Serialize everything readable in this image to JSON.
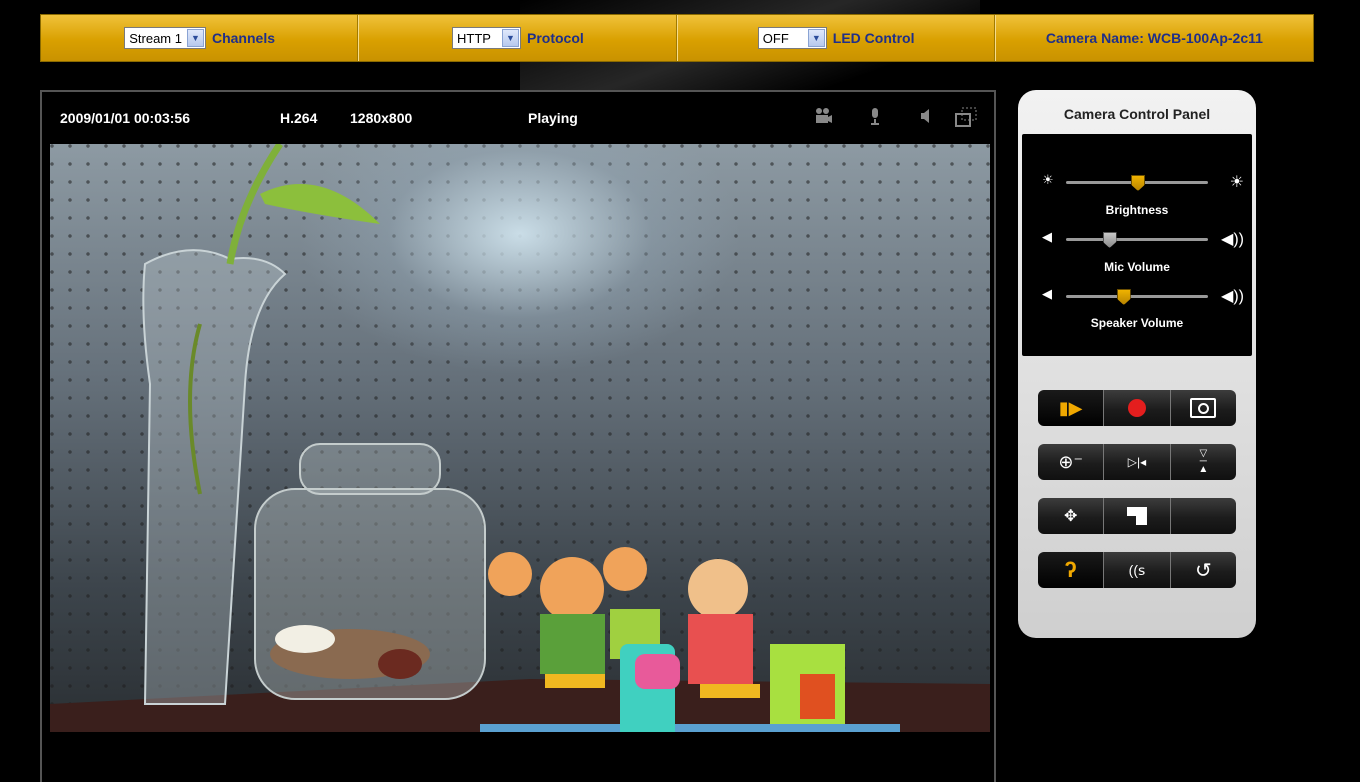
{
  "topbar": {
    "channel_value": "Stream 1",
    "channel_label": "Channels",
    "protocol_value": "HTTP",
    "protocol_label": "Protocol",
    "led_value": "OFF",
    "led_label": "LED Control",
    "camera_name": "Camera Name: WCB-100Ap-2c11"
  },
  "viewer": {
    "datetime": "2009/01/01 00:03:56",
    "codec": "H.264",
    "resolution": "1280x800",
    "status": "Playing"
  },
  "panel": {
    "title": "Camera Control Panel",
    "brightness_label": "Brightness",
    "brightness_level": 0.5,
    "mic_label": "Mic Volume",
    "mic_level": 0.3,
    "speaker_label": "Speaker Volume",
    "speaker_level": 0.4
  },
  "colors": {
    "accent": "#d9a000",
    "label_blue": "#1f2f8a",
    "record_red": "#e41e1e"
  },
  "icons": {
    "header": [
      "video-camera-icon",
      "microphone-icon",
      "speaker-icon",
      "fullscreen-icon"
    ],
    "controls": [
      [
        "play-icon",
        "record-icon",
        "snapshot-icon"
      ],
      [
        "zoom-icon",
        "mirror-icon",
        "flip-icon"
      ],
      [
        "pan-tilt-icon",
        "crop-icon",
        "blank"
      ],
      [
        "listen-icon",
        "talk-icon",
        "reset-icon"
      ]
    ]
  }
}
